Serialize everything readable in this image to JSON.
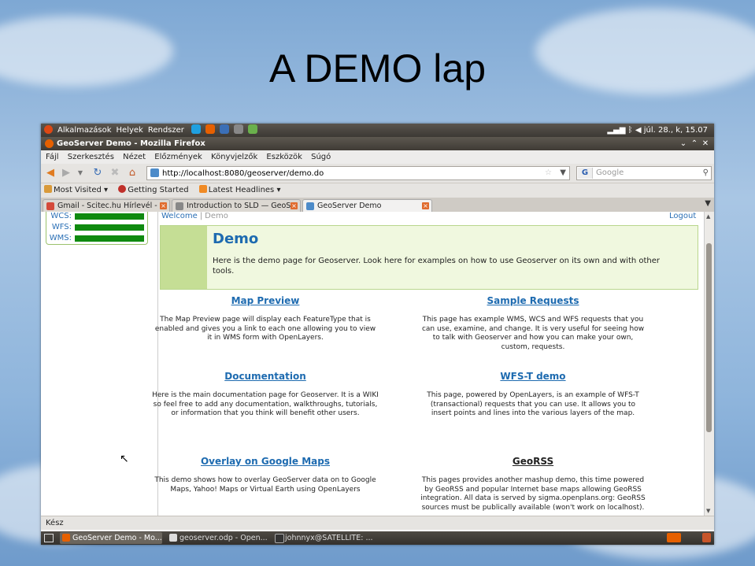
{
  "slide_title": "A DEMO lap",
  "top_panel": {
    "menus": [
      "Alkalmazások",
      "Helyek",
      "Rendszer"
    ],
    "clock": "júl. 28., k, 15.07",
    "tray_icons": [
      "signal-icon",
      "bluetooth-icon",
      "volume-icon"
    ]
  },
  "window": {
    "title": "GeoServer Demo - Mozilla Firefox",
    "controls": [
      "⌄",
      "⌃",
      "✕"
    ]
  },
  "menubar": [
    "Fájl",
    "Szerkesztés",
    "Nézet",
    "Előzmények",
    "Könyvjelzők",
    "Eszközök",
    "Súgó"
  ],
  "navbar": {
    "url": "http://localhost:8080/geoserver/demo.do",
    "search_placeholder": "Google"
  },
  "bookmarks": [
    "Most Visited",
    "Getting Started",
    "Latest Headlines"
  ],
  "tabs": [
    {
      "label": "Gmail - Scitec.hu Hírlevél - ...",
      "active": false
    },
    {
      "label": "Introduction to SLD — GeoS...",
      "active": false
    },
    {
      "label": "GeoServer Demo",
      "active": true
    }
  ],
  "sidebar": {
    "services": [
      "WCS:",
      "WFS:",
      "WMS:"
    ]
  },
  "breadcrumb": {
    "home": "Welcome",
    "sep": "|",
    "current": "Demo"
  },
  "logout": "Logout",
  "banner": {
    "title": "Demo",
    "text": "Here is the demo page for Geoserver. Look here for examples on how to use Geoserver on its own and with other tools."
  },
  "items": [
    {
      "title": "Map Preview",
      "desc": "The Map Preview page will display each FeatureType that is enabled and gives you a link to each one allowing you to view it in WMS form with OpenLayers."
    },
    {
      "title": "Sample Requests",
      "desc": "This page has example WMS, WCS and WFS requests that you can use, examine, and change. It is very useful for seeing how to talk with Geoserver and how you can make your own, custom, requests."
    },
    {
      "title": "Documentation",
      "desc": "Here is the main documentation page for Geoserver. It is a WIKI so feel free to add any documentation, walkthroughs, tutorials, or information that you think will benefit other users."
    },
    {
      "title": "WFS-T demo",
      "desc": "This page, powered by OpenLayers, is an example of WFS-T (transactional) requests that you can use. It allows you to insert points and lines into the various layers of the map."
    },
    {
      "title": "Overlay on Google Maps",
      "desc": "This demo shows how to overlay GeoServer data on to Google Maps, Yahoo! Maps or Virtual Earth using OpenLayers"
    },
    {
      "title": "GeoRSS",
      "desc": "This pages provides another mashup demo, this time powered by GeoRSS and popular Internet base maps allowing GeoRSS integration. All data is served by sigma.openplans.org: GeoRSS sources must be publically available (won't work on localhost)."
    }
  ],
  "status": "Kész",
  "taskbar": [
    {
      "label": "GeoServer Demo - Mo...",
      "active": true
    },
    {
      "label": "geoserver.odp - Open...",
      "active": false
    },
    {
      "label": "johnnyx@SATELLITE: ...",
      "active": false
    }
  ],
  "colors": {
    "link": "#1e6bb0",
    "service_bar": "#0f8a0f",
    "banner_bg": "#f0f8df"
  }
}
